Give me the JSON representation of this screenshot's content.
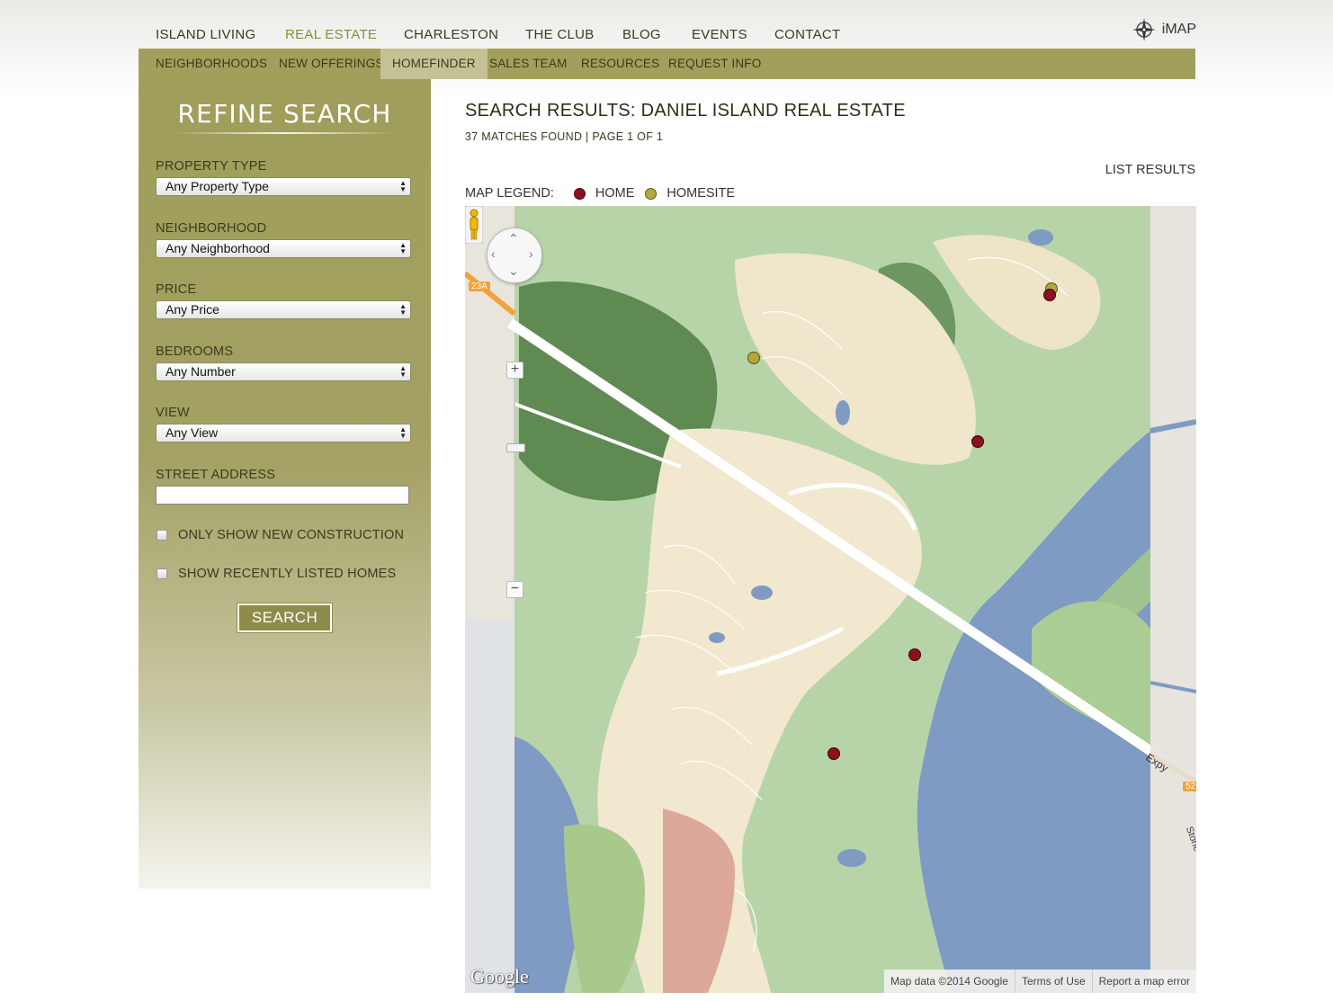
{
  "topnav": {
    "items": [
      "ISLAND LIVING",
      "REAL ESTATE",
      "CHARLESTON",
      "THE CLUB",
      "BLOG",
      "EVENTS",
      "CONTACT"
    ],
    "active": "REAL ESTATE",
    "imap_label": "iMAP"
  },
  "subnav": {
    "items": [
      "NEIGHBORHOODS",
      "NEW OFFERINGS",
      "HOMEFINDER",
      "SALES TEAM",
      "RESOURCES",
      "REQUEST INFO"
    ],
    "active": "HOMEFINDER"
  },
  "sidebar": {
    "heading": "REFINE SEARCH",
    "property_type": {
      "label": "PROPERTY TYPE",
      "value": "Any Property Type"
    },
    "neighborhood": {
      "label": "NEIGHBORHOOD",
      "value": "Any Neighborhood"
    },
    "price": {
      "label": "PRICE",
      "value": "Any Price"
    },
    "bedrooms": {
      "label": "BEDROOMS",
      "value": "Any Number"
    },
    "view": {
      "label": "VIEW",
      "value": "Any View"
    },
    "street_address": {
      "label": "STREET ADDRESS",
      "value": ""
    },
    "new_construction_label": "ONLY SHOW NEW CONSTRUCTION",
    "recently_listed_label": "SHOW RECENTLY LISTED HOMES",
    "search_button": "SEARCH"
  },
  "results": {
    "title": "SEARCH RESULTS: DANIEL ISLAND REAL ESTATE",
    "subtitle": "37 MATCHES FOUND | PAGE 1 OF 1",
    "list_results_link": "LIST RESULTS",
    "legend_label": "MAP LEGEND:",
    "legend_home": "HOME",
    "legend_homesite": "HOMESITE"
  },
  "map": {
    "google_logo": "Google",
    "footer": {
      "data": "Map data ©2014 Google",
      "terms": "Terms of Use",
      "report": "Report a map error"
    },
    "road_labels": {
      "route_23a": "23A",
      "route_52": "52",
      "expy": "Expy",
      "stone": "Stone"
    },
    "colors": {
      "water": "#7d98c2",
      "marsh": "#b3d3a8",
      "land": "#f3ead2",
      "home_marker": "#8c1020",
      "homesite_marker": "#b2a63e"
    }
  }
}
